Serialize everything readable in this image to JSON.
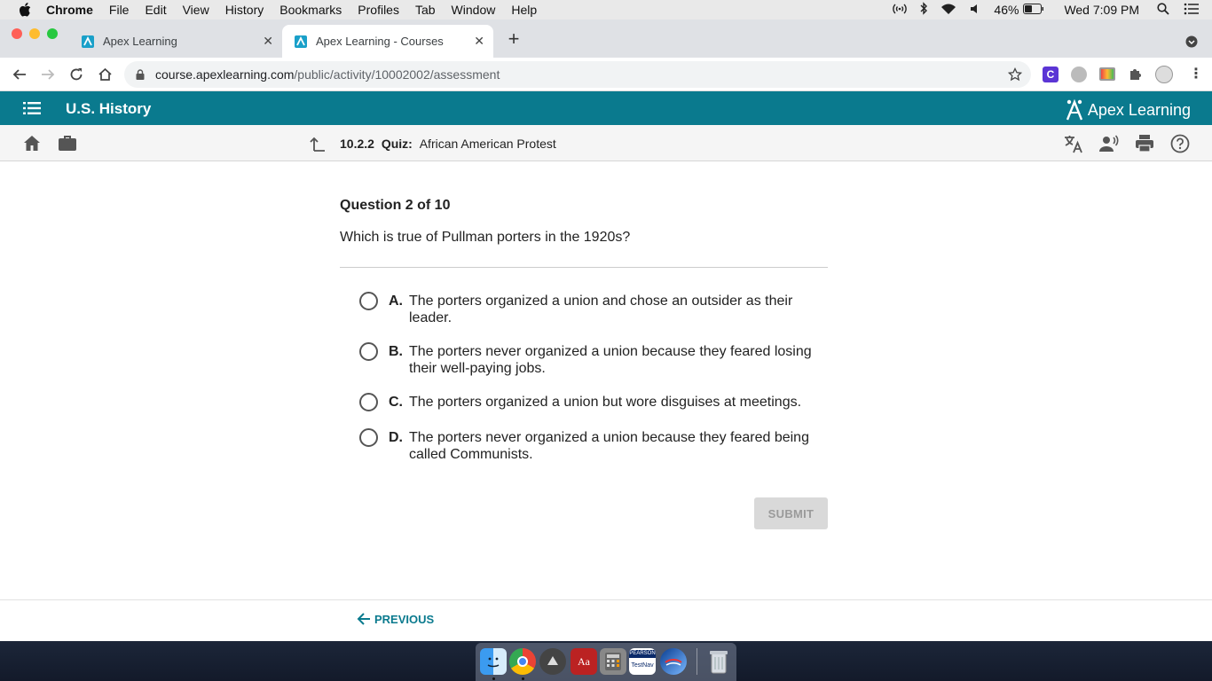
{
  "menubar": {
    "app": "Chrome",
    "items": [
      "File",
      "Edit",
      "View",
      "History",
      "Bookmarks",
      "Profiles",
      "Tab",
      "Window",
      "Help"
    ],
    "battery": "46%",
    "clock": "Wed 7:09 PM"
  },
  "tabs": [
    {
      "title": "Apex Learning"
    },
    {
      "title": "Apex Learning - Courses"
    }
  ],
  "address": {
    "host": "course.apexlearning.com",
    "path": "/public/activity/10002002/assessment"
  },
  "app": {
    "course_title": "U.S. History",
    "brand": "Apex Learning",
    "lesson_number": "10.2.2",
    "lesson_type": "Quiz:",
    "lesson_title": "African American Protest"
  },
  "question": {
    "counter": "Question 2 of 10",
    "text": "Which is true of Pullman porters in the 1920s?",
    "options": [
      {
        "letter": "A.",
        "text": "The porters organized a union and chose an outsider as their leader."
      },
      {
        "letter": "B.",
        "text": "The porters never organized a union because they feared losing their well-paying jobs."
      },
      {
        "letter": "C.",
        "text": "The porters organized a union but wore disguises at meetings."
      },
      {
        "letter": "D.",
        "text": "The porters never organized a union because they feared being called Communists."
      }
    ],
    "submit_label": "SUBMIT"
  },
  "footer": {
    "previous_label": "PREVIOUS"
  },
  "dock": {
    "testnav_top": "PEARSON",
    "testnav_bottom": "TestNav",
    "dictionary": "Aa"
  },
  "colors": {
    "brand_teal": "#0a7a8e",
    "submit_disabled": "#d9d9d9"
  }
}
